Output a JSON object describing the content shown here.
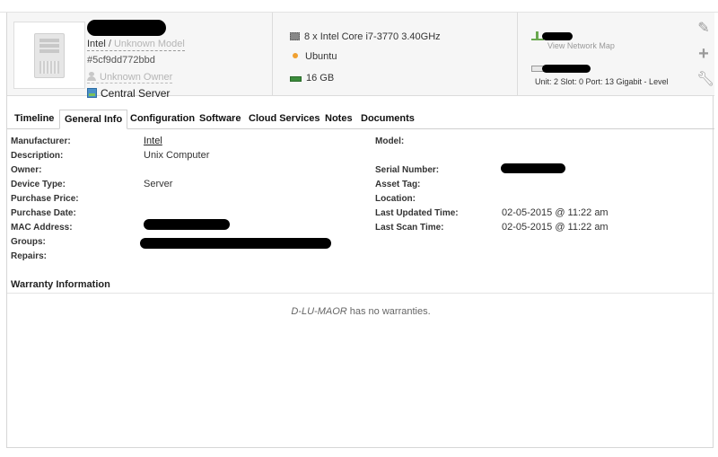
{
  "device": {
    "manufacturer": "Intel",
    "separator": "/",
    "model_placeholder": "Unknown Model",
    "id_hash": "#5cf9dd772bbd",
    "owner_placeholder": "Unknown Owner",
    "location": "Central Server"
  },
  "specs": {
    "cpu": "8 x Intel Core i7-3770 3.40GHz",
    "os": "Ubuntu",
    "ram": "16 GB"
  },
  "network": {
    "view_map_label": "View Network Map",
    "port_info": "Unit: 2 Slot: 0 Port: 13 Gigabit - Level"
  },
  "tabs": [
    "Timeline",
    "General Info",
    "Configuration",
    "Software",
    "Cloud Services",
    "Notes",
    "Documents"
  ],
  "active_tab": "General Info",
  "general_info": {
    "left": [
      {
        "label": "Manufacturer:",
        "value": "Intel"
      },
      {
        "label": "Description:",
        "value": "Unix Computer"
      },
      {
        "label": "Owner:",
        "value": ""
      },
      {
        "label": "Device Type:",
        "value": "Server"
      },
      {
        "label": "Purchase Price:",
        "value": ""
      },
      {
        "label": "Purchase Date:",
        "value": ""
      },
      {
        "label": "MAC Address:",
        "value": ""
      },
      {
        "label": "Groups:",
        "value": ""
      },
      {
        "label": "Repairs:",
        "value": ""
      }
    ],
    "right": [
      {
        "label": "Model:",
        "value": ""
      },
      {
        "label": "Serial Number:",
        "value": ""
      },
      {
        "label": "Asset Tag:",
        "value": ""
      },
      {
        "label": "Location:",
        "value": ""
      },
      {
        "label": "Last Updated Time:",
        "value": "02-05-2015 @ 11:22 am"
      },
      {
        "label": "Last Scan Time:",
        "value": "02-05-2015 @ 11:22 am"
      }
    ]
  },
  "warranty": {
    "title": "Warranty Information",
    "device_name": "D-LU-MAOR",
    "message": " has no warranties."
  },
  "icons": {
    "edit": "pencil-icon",
    "add": "plus-icon",
    "tools": "wrench-icon"
  }
}
